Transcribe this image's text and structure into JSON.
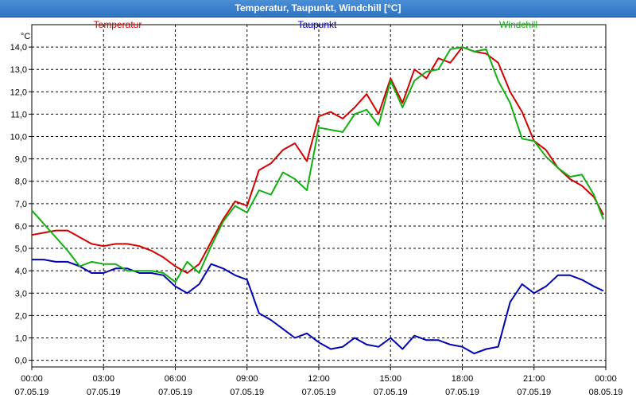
{
  "window": {
    "title": "Temperatur, Taupunkt, Windchill [°C]"
  },
  "colors": {
    "temperatur": "#d40000",
    "taupunkt": "#0000b4",
    "windchill": "#10b010",
    "grid": "#000000",
    "axis": "#000000",
    "titlebar": "#3a80cc"
  },
  "chart_data": {
    "type": "line",
    "title": "Temperatur, Taupunkt, Windchill [°C]",
    "ylabel": "°C",
    "xlabel": "",
    "ylim": [
      -0.3,
      15.0
    ],
    "xlim": [
      0,
      24
    ],
    "grid": true,
    "legend_placement": "top",
    "yticks": [
      0.0,
      1.0,
      2.0,
      3.0,
      4.0,
      5.0,
      6.0,
      7.0,
      8.0,
      9.0,
      10.0,
      11.0,
      12.0,
      13.0,
      14.0
    ],
    "ytick_labels": [
      "0,0",
      "1,0",
      "2,0",
      "3,0",
      "4,0",
      "5,0",
      "6,0",
      "7,0",
      "8,0",
      "9,0",
      "10,0",
      "11,0",
      "12,0",
      "13,0",
      "14,0"
    ],
    "xticks": [
      0,
      3,
      6,
      9,
      12,
      15,
      18,
      21,
      24
    ],
    "xtick_labels": [
      {
        "time": "00:00",
        "date": "07.05.19"
      },
      {
        "time": "03:00",
        "date": "07.05.19"
      },
      {
        "time": "06:00",
        "date": "07.05.19"
      },
      {
        "time": "09:00",
        "date": "07.05.19"
      },
      {
        "time": "12:00",
        "date": "07.05.19"
      },
      {
        "time": "15:00",
        "date": "07.05.19"
      },
      {
        "time": "18:00",
        "date": "07.05.19"
      },
      {
        "time": "21:00",
        "date": "07.05.19"
      },
      {
        "time": "00:00",
        "date": "08.05.19"
      }
    ],
    "series": [
      {
        "name": "Temperatur",
        "color": "#d40000",
        "x": [
          0,
          0.5,
          1,
          1.5,
          2,
          2.5,
          3,
          3.5,
          4,
          4.5,
          5,
          5.5,
          6,
          6.5,
          7,
          7.5,
          8,
          8.5,
          9,
          9.5,
          10,
          10.5,
          11,
          11.5,
          12,
          12.5,
          13,
          13.5,
          14,
          14.5,
          15,
          15.5,
          16,
          16.5,
          17,
          17.5,
          18,
          18.5,
          19,
          19.5,
          20,
          20.5,
          21,
          21.5,
          22,
          22.5,
          23,
          23.5,
          23.9
        ],
        "y": [
          5.6,
          5.7,
          5.8,
          5.8,
          5.5,
          5.2,
          5.1,
          5.2,
          5.2,
          5.1,
          4.9,
          4.6,
          4.2,
          3.9,
          4.3,
          5.3,
          6.3,
          7.1,
          6.9,
          8.5,
          8.8,
          9.4,
          9.7,
          8.9,
          10.9,
          11.1,
          10.8,
          11.3,
          11.9,
          11.0,
          12.6,
          11.5,
          13.0,
          12.6,
          13.5,
          13.3,
          14.0,
          13.8,
          13.7,
          13.3,
          12.0,
          11.1,
          9.8,
          9.4,
          8.6,
          8.1,
          7.8,
          7.3,
          6.5
        ]
      },
      {
        "name": "Taupunkt",
        "color": "#0000b4",
        "x": [
          0,
          0.5,
          1,
          1.5,
          2,
          2.5,
          3,
          3.5,
          4,
          4.5,
          5,
          5.5,
          6,
          6.5,
          7,
          7.5,
          8,
          8.5,
          9,
          9.5,
          10,
          10.5,
          11,
          11.5,
          12,
          12.5,
          13,
          13.5,
          14,
          14.5,
          15,
          15.5,
          16,
          16.5,
          17,
          17.5,
          18,
          18.5,
          19,
          19.5,
          20,
          20.5,
          21,
          21.5,
          22,
          22.5,
          23,
          23.5,
          23.9
        ],
        "y": [
          4.5,
          4.5,
          4.4,
          4.4,
          4.2,
          3.9,
          3.9,
          4.1,
          4.1,
          3.9,
          3.9,
          3.8,
          3.3,
          3.0,
          3.4,
          4.3,
          4.1,
          3.8,
          3.6,
          2.1,
          1.8,
          1.4,
          1.0,
          1.2,
          0.8,
          0.5,
          0.6,
          1.0,
          0.7,
          0.6,
          1.0,
          0.5,
          1.1,
          0.9,
          0.9,
          0.7,
          0.6,
          0.3,
          0.5,
          0.6,
          2.6,
          3.4,
          3.0,
          3.3,
          3.8,
          3.8,
          3.6,
          3.3,
          3.1
        ]
      },
      {
        "name": "Windchill",
        "color": "#10b010",
        "x": [
          0,
          0.5,
          1,
          1.5,
          2,
          2.5,
          3,
          3.5,
          4,
          4.5,
          5,
          5.5,
          6,
          6.5,
          7,
          7.5,
          8,
          8.5,
          9,
          9.5,
          10,
          10.5,
          11,
          11.5,
          12,
          12.5,
          13,
          13.5,
          14,
          14.5,
          15,
          15.5,
          16,
          16.5,
          17,
          17.5,
          18,
          18.5,
          19,
          19.5,
          20,
          20.5,
          21,
          21.5,
          22,
          22.5,
          23,
          23.5,
          23.9
        ],
        "y": [
          6.7,
          6.1,
          5.5,
          4.9,
          4.2,
          4.4,
          4.3,
          4.3,
          4.0,
          4.0,
          4.0,
          3.9,
          3.5,
          4.4,
          3.9,
          5.1,
          6.2,
          6.9,
          6.6,
          7.6,
          7.4,
          8.4,
          8.1,
          7.6,
          10.4,
          10.3,
          10.2,
          11.0,
          11.2,
          10.5,
          12.5,
          11.3,
          12.5,
          12.9,
          13.0,
          13.9,
          14.0,
          13.8,
          13.9,
          12.5,
          11.5,
          9.9,
          9.8,
          9.1,
          8.6,
          8.2,
          8.3,
          7.4,
          6.3
        ]
      }
    ]
  }
}
